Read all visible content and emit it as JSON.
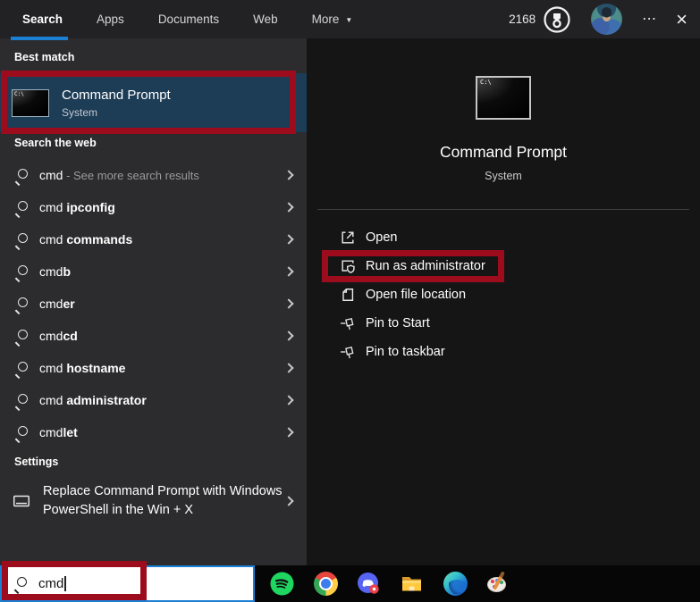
{
  "topbar": {
    "tabs": [
      {
        "label": "Search",
        "active": true
      },
      {
        "label": "Apps",
        "active": false
      },
      {
        "label": "Documents",
        "active": false
      },
      {
        "label": "Web",
        "active": false
      },
      {
        "label": "More",
        "active": false,
        "has_dropdown": true
      }
    ],
    "dropdown_caret_glyph": "▼",
    "rewards_points": "2168",
    "ellipsis_glyph": "⋯",
    "close_glyph": "×"
  },
  "best_match": {
    "header": "Best match",
    "title": "Command Prompt",
    "subtitle": "System",
    "icon_text": "C:\\"
  },
  "web_search": {
    "header": "Search the web",
    "items": [
      {
        "prefix": "cmd",
        "bold": "",
        "suffix": " - See more search results"
      },
      {
        "prefix": "cmd ",
        "bold": "ipconfig",
        "suffix": ""
      },
      {
        "prefix": "cmd ",
        "bold": "commands",
        "suffix": ""
      },
      {
        "prefix": "cmd",
        "bold": "b",
        "suffix": ""
      },
      {
        "prefix": "cmd",
        "bold": "er",
        "suffix": ""
      },
      {
        "prefix": "cmd",
        "bold": "cd",
        "suffix": ""
      },
      {
        "prefix": "cmd ",
        "bold": "hostname",
        "suffix": ""
      },
      {
        "prefix": "cmd ",
        "bold": "administrator",
        "suffix": ""
      },
      {
        "prefix": "cmd",
        "bold": "let",
        "suffix": ""
      }
    ]
  },
  "settings": {
    "header": "Settings",
    "item_label": "Replace Command Prompt with Windows PowerShell in the Win + X"
  },
  "preview": {
    "title": "Command Prompt",
    "subtitle": "System",
    "icon_text": "C:\\",
    "actions": [
      {
        "label": "Open",
        "icon": "open-icon",
        "annotated": false
      },
      {
        "label": "Run as administrator",
        "icon": "run-as-admin-icon",
        "annotated": true
      },
      {
        "label": "Open file location",
        "icon": "open-file-location-icon",
        "annotated": false
      },
      {
        "label": "Pin to Start",
        "icon": "pin-icon",
        "annotated": false
      },
      {
        "label": "Pin to taskbar",
        "icon": "pin-icon",
        "annotated": false
      }
    ]
  },
  "search_box": {
    "value": "cmd"
  },
  "taskbar": {
    "icons": [
      "spotify",
      "chrome",
      "discord",
      "file-explorer",
      "edge",
      "paint-3d"
    ]
  },
  "colors": {
    "accent": "#1b7fd4",
    "selection": "#1d3c56",
    "annotation": "#9d0c1d"
  }
}
